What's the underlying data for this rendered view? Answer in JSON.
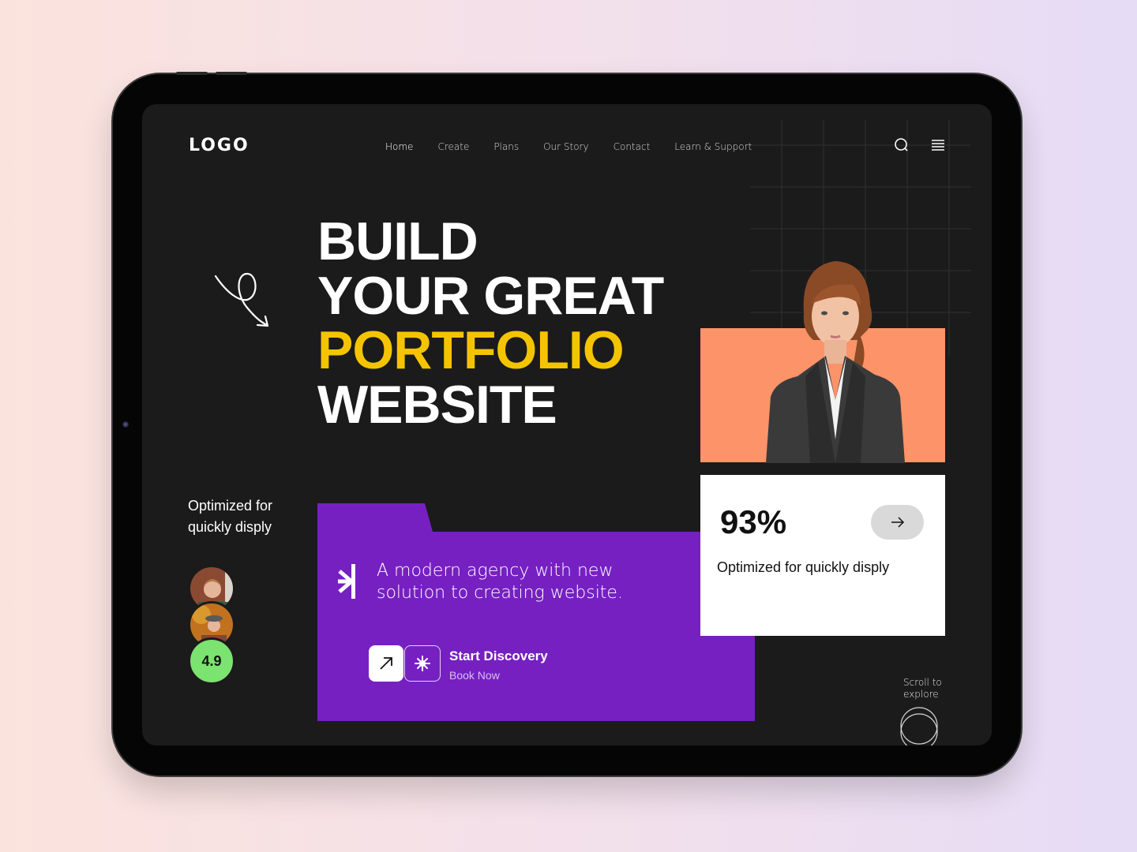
{
  "brand": {
    "logo": "LOGO"
  },
  "nav": {
    "items": [
      {
        "label": "Home",
        "active": true
      },
      {
        "label": "Create",
        "active": false
      },
      {
        "label": "Plans",
        "active": false
      },
      {
        "label": "Our Story",
        "active": false
      },
      {
        "label": "Contact",
        "active": false
      },
      {
        "label": "Learn & Support",
        "active": false
      }
    ],
    "icons": {
      "search": "search-icon",
      "menu": "hamburger-menu-icon"
    }
  },
  "hero": {
    "headline": {
      "line1": "BUILD",
      "line2": "YOUR GREAT",
      "line3": "PORTFOLIO",
      "line4": "WEBSITE"
    },
    "highlight_color": "#f5c400",
    "decor_icon": "squiggle-arrow-icon"
  },
  "left_panel": {
    "caption": "Optimized for quickly disply",
    "rating": "4.9",
    "rating_color": "#7be36f"
  },
  "agency_card": {
    "icon": "asterisk-bar-icon",
    "text": "A modern agency with new solution to creating website.",
    "cta_title": "Start Discovery",
    "cta_subtitle": "Book Now",
    "cta_icons": [
      "arrow-up-right-icon",
      "sparkle-icon"
    ],
    "color": "#7620c2"
  },
  "photo_card": {
    "background": "#fc9369"
  },
  "stat_card": {
    "value": "93%",
    "description": "Optimized for quickly disply",
    "button_icon": "arrow-right-icon"
  },
  "scroll": {
    "label_line1": "Scroll to",
    "label_line2": "explore"
  }
}
